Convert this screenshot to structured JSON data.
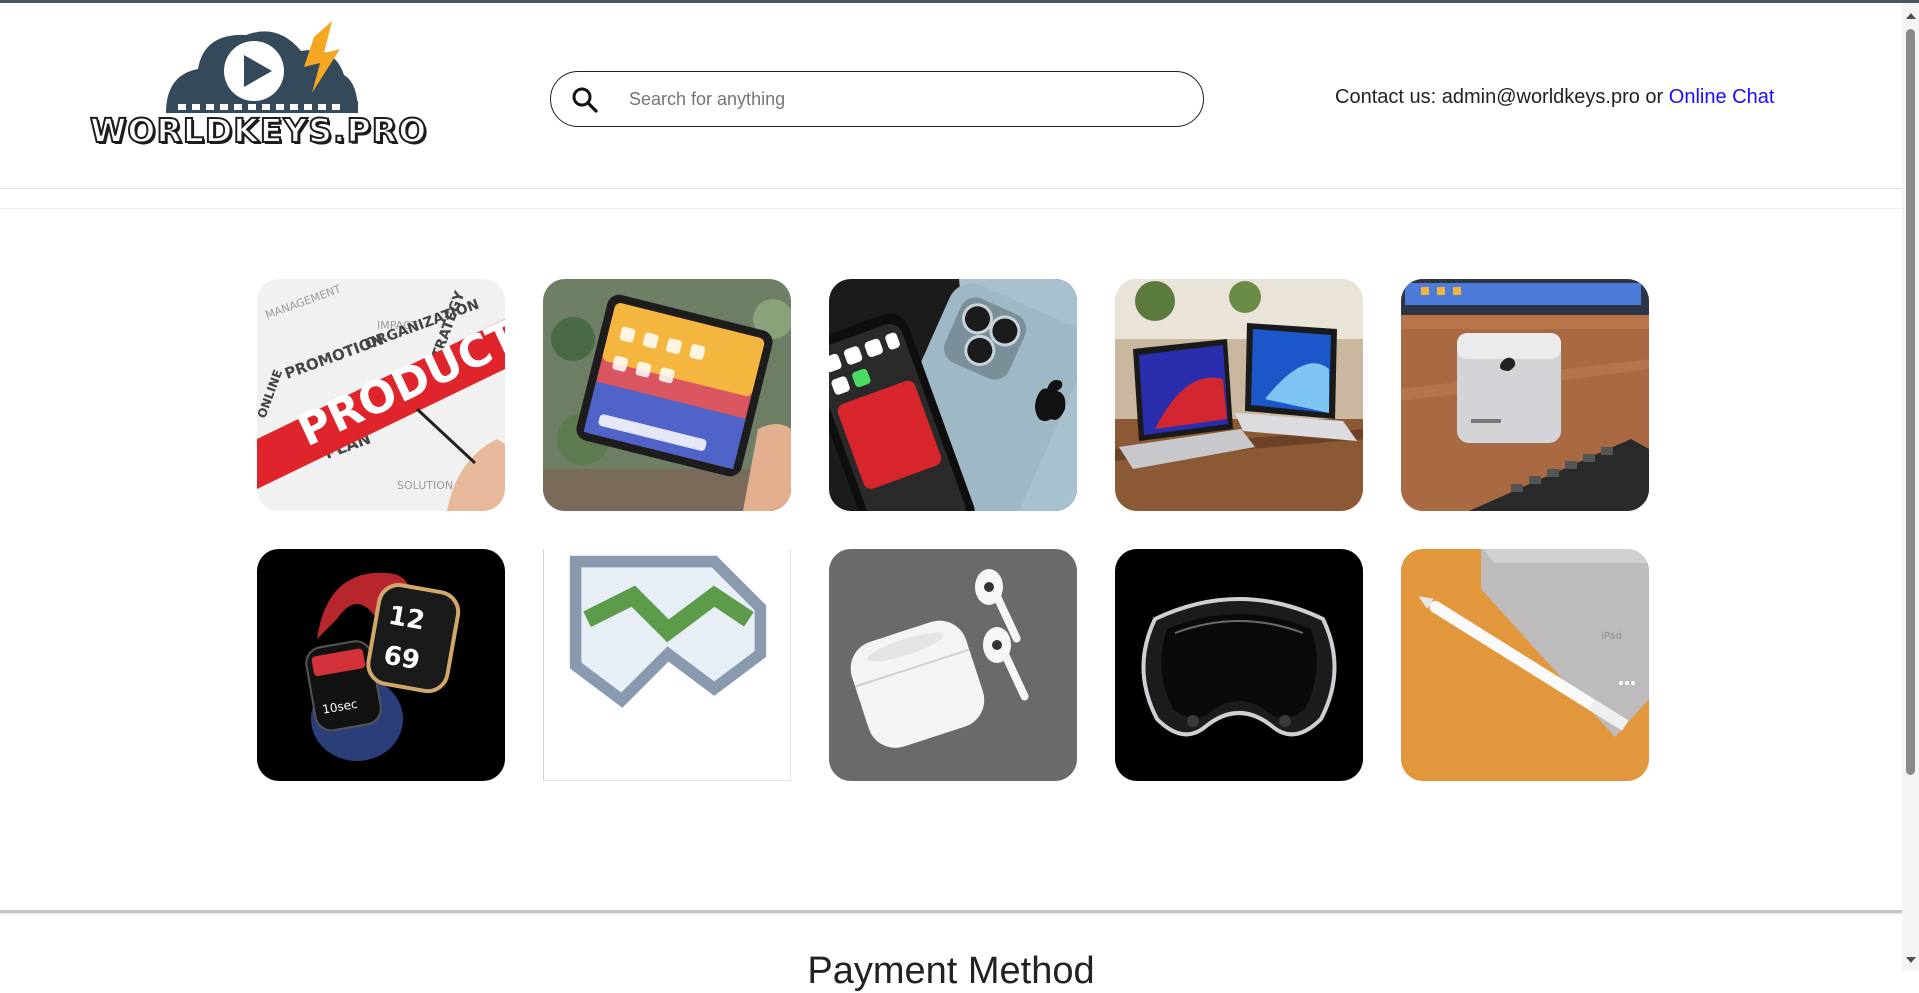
{
  "brand": {
    "name": "WORLDKEYS.PRO",
    "colors": {
      "cloud": "#34495a",
      "bolt": "#f5a623"
    }
  },
  "search": {
    "placeholder": "Search for anything",
    "value": ""
  },
  "contact": {
    "prefix": "Contact us: admin@worldkeys.pro or ",
    "chat_label": "Online Chat",
    "link_color": "#1a0dff"
  },
  "products": [
    {
      "image": "product-strategy-wordcloud"
    },
    {
      "image": "ipad-in-hand"
    },
    {
      "image": "iphone-pro"
    },
    {
      "image": "macbook-pro-laptops"
    },
    {
      "image": "mac-studio"
    },
    {
      "image": "apple-watch"
    },
    {
      "image": "broken-image"
    },
    {
      "image": "airpods"
    },
    {
      "image": "vision-pro-headset"
    },
    {
      "image": "apple-pencil-ipad"
    }
  ],
  "sections": {
    "payment_title": "Payment Method"
  }
}
